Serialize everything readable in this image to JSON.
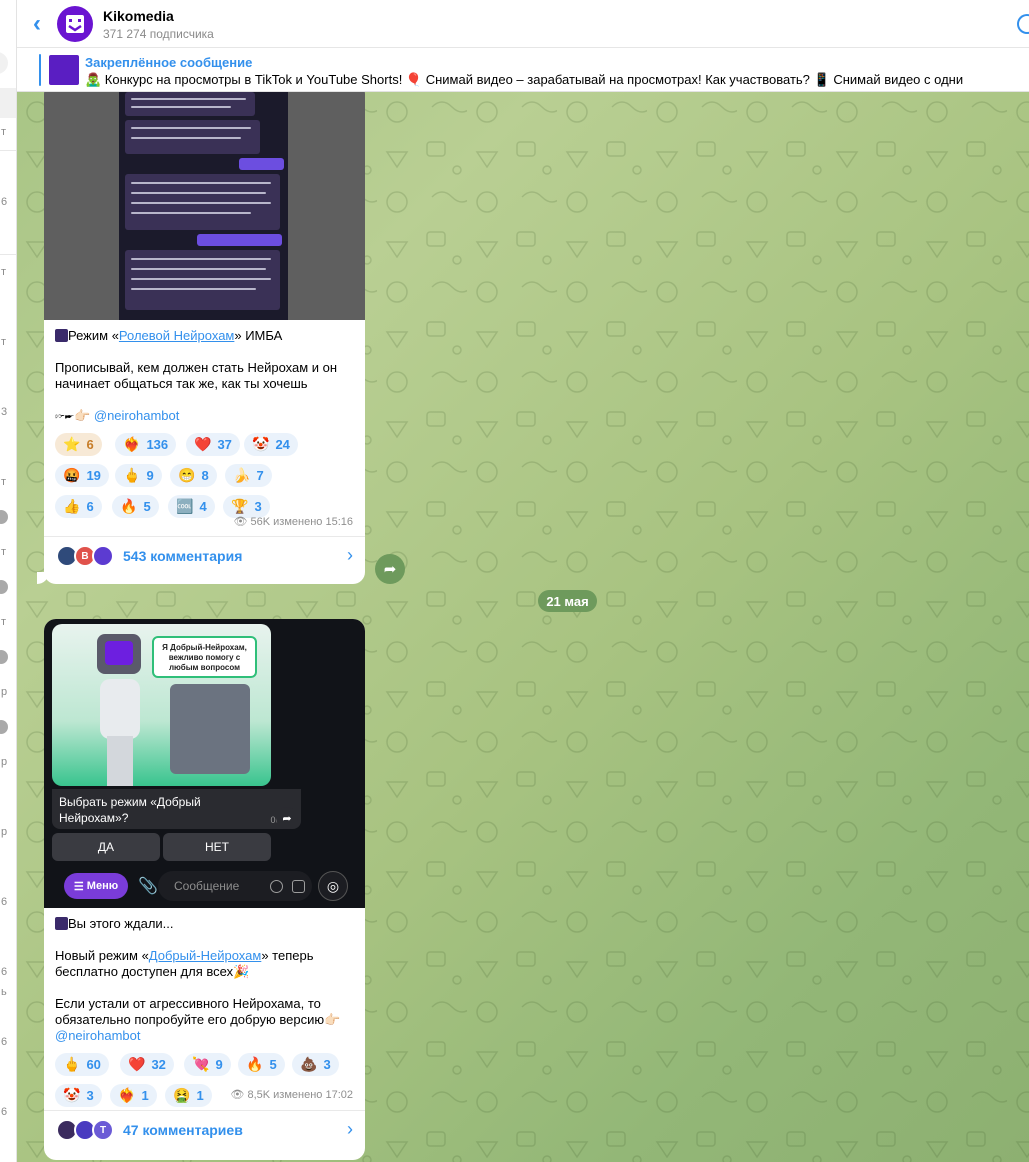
{
  "channel": {
    "title": "Kikomedia",
    "subscribers": "371 274 подписчика"
  },
  "pinned": {
    "title": "Закреплённое сообщение",
    "text": "🧟‍♂️ Конкурс на просмотры в TikTok и YouTube Shorts!  🎈 Снимай видео – зарабатывай на просмотрах!   Как участвовать?  📱 Снимай видео с одни"
  },
  "left_strip": {
    "fragments": [
      "т",
      "6",
      "т",
      "т",
      "3",
      "т",
      "т",
      "т",
      "р",
      "р",
      "р",
      "6",
      "6",
      "ь",
      "6",
      "6"
    ]
  },
  "date_divider": "21 мая",
  "posts": [
    {
      "line1_prefix": "Режим «",
      "line1_link": "Ролевой Нейрохам",
      "line1_suffix": "» ИМБА",
      "body": "Прописывай, кем должен стать Нейрохам и он начинает общаться так же, как ты хочешь",
      "mention": "@neirohambot",
      "reactions": [
        {
          "icon": "⭐",
          "count": "6",
          "active": true
        },
        {
          "icon": "❤️‍🔥",
          "count": "136"
        },
        {
          "icon": "❤️",
          "count": "37"
        },
        {
          "icon": "🤡",
          "count": "24"
        },
        {
          "icon": "🤬",
          "count": "19"
        },
        {
          "icon": "🖕",
          "count": "9"
        },
        {
          "icon": "😁",
          "count": "8"
        },
        {
          "icon": "🍌",
          "count": "7"
        },
        {
          "icon": "👍",
          "count": "6"
        },
        {
          "icon": "🔥",
          "count": "5"
        },
        {
          "icon": "🆒",
          "count": "4"
        },
        {
          "icon": "🏆",
          "count": "3"
        }
      ],
      "views": "56K",
      "edited": "изменено 15:16",
      "comments": "543 комментария",
      "comment_avatars": [
        "",
        "B",
        ""
      ]
    },
    {
      "bot_card": {
        "speech": "Я Добрый-Нейрохам, вежливо помогу с любым вопросом",
        "question": "Выбрать режим «Добрый Нейрохам»?",
        "time": "06:24",
        "yes": "ДА",
        "no": "НЕТ",
        "menu": "Меню",
        "input_placeholder": "Сообщение"
      },
      "line1": "Вы этого ждали...",
      "p2_prefix": "Новый режим «",
      "p2_link": "Добрый-Нейрохам",
      "p2_suffix": "» теперь бесплатно доступен для всех🎉",
      "p3": "Если устали от агрессивного Нейрохама, то обязательно попробуйте его добрую версию👉🏻",
      "mention": "@neirohambot",
      "reactions": [
        {
          "icon": "🖕",
          "count": "60"
        },
        {
          "icon": "❤️",
          "count": "32"
        },
        {
          "icon": "💘",
          "count": "9"
        },
        {
          "icon": "🔥",
          "count": "5"
        },
        {
          "icon": "💩",
          "count": "3"
        },
        {
          "icon": "🤡",
          "count": "3"
        },
        {
          "icon": "❤️‍🔥",
          "count": "1"
        },
        {
          "icon": "🤮",
          "count": "1"
        }
      ],
      "views": "8,5K",
      "edited": "изменено 17:02",
      "comments": "47 комментариев",
      "comment_avatars": [
        "",
        "",
        "T"
      ]
    }
  ],
  "colors": {
    "accent": "#3390ec",
    "brand_purple": "#6a14d1",
    "chat_bg": "#a9c586"
  }
}
